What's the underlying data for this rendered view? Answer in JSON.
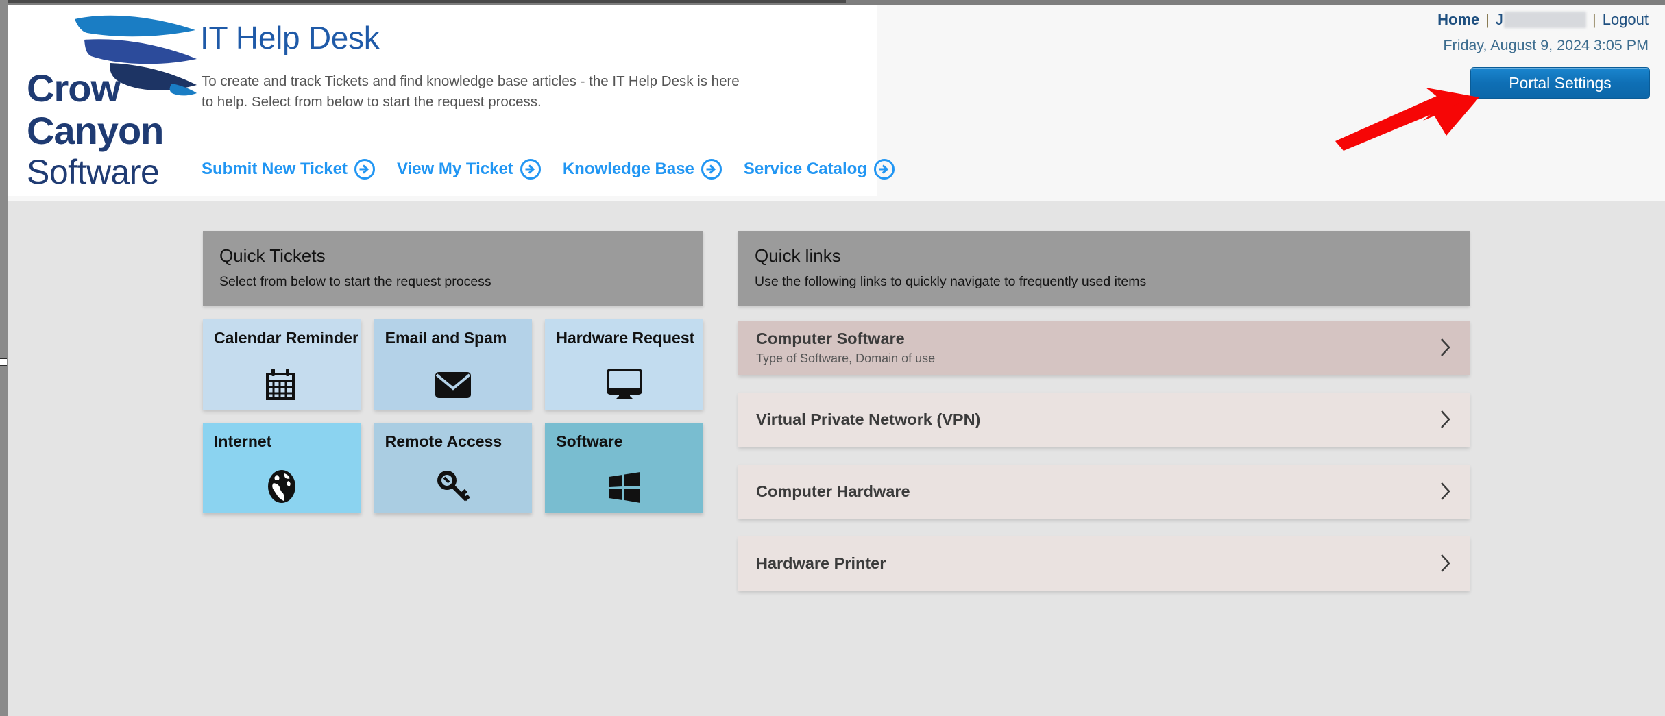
{
  "header": {
    "logo": {
      "alt": "Crow Canyon Software",
      "line1": "Crow",
      "line2": "Canyon",
      "line3": "Software"
    },
    "title": "IT Help Desk",
    "subtitle": "To create and track Tickets and find knowledge base articles - the IT Help Desk is here to help. Select from below to start the request process.",
    "nav_links": [
      {
        "label": "Submit New Ticket",
        "icon": "arrow-right-circle-icon"
      },
      {
        "label": "View My Ticket",
        "icon": "arrow-right-circle-icon"
      },
      {
        "label": "Knowledge Base",
        "icon": "arrow-right-circle-icon"
      },
      {
        "label": "Service Catalog",
        "icon": "arrow-right-circle-icon"
      }
    ],
    "account": {
      "home_label": "Home",
      "separator": "|",
      "user_prefix": "J",
      "logout_label": "Logout"
    },
    "datetime": "Friday, August 9, 2024 3:05 PM",
    "portal_settings_label": "Portal Settings"
  },
  "quick_tickets": {
    "heading": "Quick Tickets",
    "description": "Select from below to start the request process",
    "tiles": [
      {
        "label": "Calendar Reminder",
        "icon": "calendar-icon",
        "color": "#c5dcee"
      },
      {
        "label": "Email and Spam",
        "icon": "envelope-icon",
        "color": "#b4d2e8"
      },
      {
        "label": "Hardware Request",
        "icon": "monitor-icon",
        "color": "#c2dcef"
      },
      {
        "label": "Internet",
        "icon": "globe-icon",
        "color": "#8bd3f0"
      },
      {
        "label": "Remote Access",
        "icon": "key-icon",
        "color": "#aacde2"
      },
      {
        "label": "Software",
        "icon": "windows-icon",
        "color": "#79bdd0"
      }
    ]
  },
  "quick_links": {
    "heading": "Quick links",
    "description": "Use the following links to quickly navigate to frequently used items",
    "items": [
      {
        "title": "Computer Software",
        "subtitle": "Type of Software, Domain of use",
        "state": "active",
        "icon": "chevron-right-icon"
      },
      {
        "title": "Virtual Private Network (VPN)",
        "subtitle": "",
        "state": "default",
        "icon": "chevron-right-icon"
      },
      {
        "title": "Computer Hardware",
        "subtitle": "",
        "state": "default",
        "icon": "chevron-right-icon"
      },
      {
        "title": "Hardware Printer",
        "subtitle": "",
        "state": "default",
        "icon": "chevron-right-icon"
      }
    ]
  },
  "annotation": {
    "type": "arrow",
    "color": "#f60606",
    "points_to": "Portal Settings"
  },
  "colors": {
    "accent_blue": "#2196f3",
    "title_blue": "#1f5aa8",
    "button_blue": "#0f6fb5",
    "panel_header_gray": "#9b9b9b",
    "body_background": "#e4e4e4",
    "quicklink_bg": "#eae2e0",
    "quicklink_active_bg": "#d5c4c2",
    "annotation_red": "#f60606"
  }
}
